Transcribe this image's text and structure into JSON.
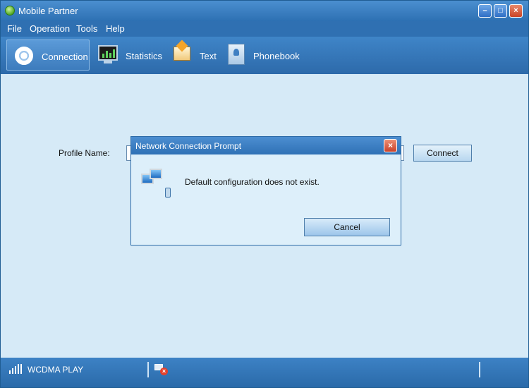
{
  "window": {
    "title": "Mobile Partner"
  },
  "menu": [
    "File",
    "Operation",
    "Tools",
    "Help"
  ],
  "toolbar": [
    {
      "label": "Connection",
      "icon": "connection-icon"
    },
    {
      "label": "Statistics",
      "icon": "statistics-icon"
    },
    {
      "label": "Text",
      "icon": "text-envelope-icon"
    },
    {
      "label": "Phonebook",
      "icon": "phonebook-icon"
    }
  ],
  "connection": {
    "profile_label": "Profile Name:",
    "profile_value": "",
    "connect_label": "Connect"
  },
  "dialog": {
    "title": "Network Connection Prompt",
    "message": "Default configuration does not exist.",
    "cancel_label": "Cancel",
    "icon": "network-computers-icon"
  },
  "status": {
    "network": "WCDMA  PLAY",
    "connection_state_icon": "disconnected-icon"
  },
  "colors": {
    "titlebar": "#2f70b2",
    "content_bg": "#d6eaf7",
    "close_button": "#c94325"
  }
}
